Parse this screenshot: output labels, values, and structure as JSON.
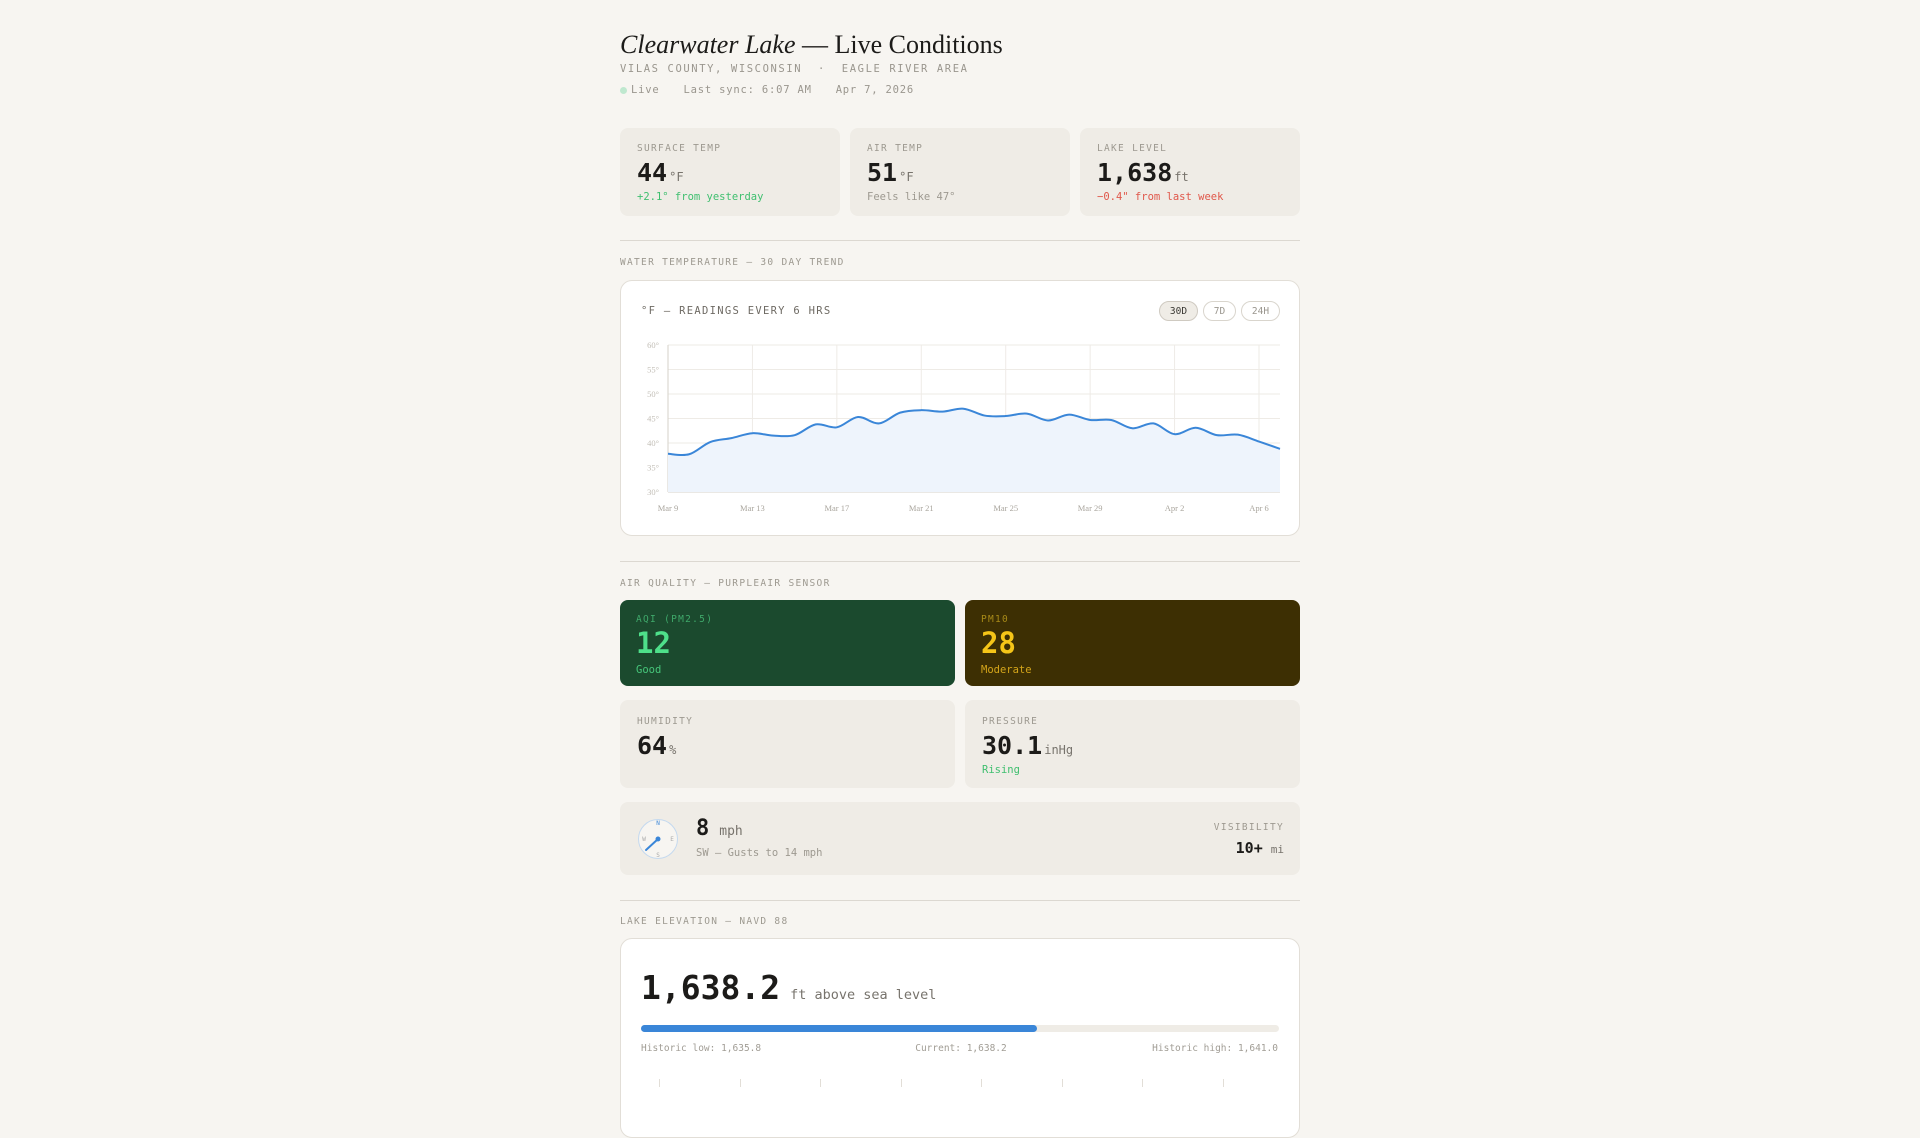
{
  "header": {
    "title_italic": "Clearwater Lake",
    "title_rest": " — Live Conditions",
    "location": "VILAS COUNTY, WISCONSIN  ·  EAGLE RIVER AREA",
    "live_label": "Live",
    "last_sync": "Last sync: 6:07 AM",
    "date": "Apr 7, 2026"
  },
  "stats": [
    {
      "label": "SURFACE TEMP",
      "value": "44",
      "unit": "°F",
      "note": "+2.1° from yesterday",
      "note_color": "#3fbf6f"
    },
    {
      "label": "AIR TEMP",
      "value": "51",
      "unit": "°F",
      "note": "Feels like 47°",
      "note_color": "#9d9990"
    },
    {
      "label": "LAKE LEVEL",
      "value": "1,638",
      "unit": "ft",
      "note": "−0.4\" from last week",
      "note_color": "#e0574a"
    }
  ],
  "water": {
    "section": "WATER TEMPERATURE — 30 DAY TREND",
    "subtitle": "°F — READINGS EVERY 6 HRS",
    "ranges": [
      "30D",
      "7D",
      "24H"
    ],
    "active_range": "30D"
  },
  "chart_data": {
    "type": "area",
    "title": "°F — READINGS EVERY 6 HRS",
    "xlabel": "",
    "ylabel": "°F",
    "ylim": [
      30,
      60
    ],
    "yticks": [
      "60°",
      "55°",
      "50°",
      "45°",
      "40°",
      "35°",
      "30°"
    ],
    "xticks": [
      "Mar 9",
      "Mar 13",
      "Mar 17",
      "Mar 21",
      "Mar 25",
      "Mar 29",
      "Apr 2",
      "Apr 6"
    ],
    "x_start": "Mar 9",
    "values": [
      37.8,
      37.7,
      40.2,
      41.0,
      42.0,
      41.5,
      41.6,
      43.8,
      43.2,
      45.3,
      44.0,
      46.2,
      46.7,
      46.4,
      47.0,
      45.6,
      45.5,
      46.0,
      44.6,
      45.8,
      44.7,
      44.7,
      43.0,
      44.0,
      41.8,
      43.1,
      41.6,
      41.7,
      40.3,
      38.8
    ],
    "color": "#3a86d8",
    "grid": true
  },
  "air": {
    "section": "AIR QUALITY — PURPLEAIR SENSOR",
    "aqi": {
      "label": "AQI (PM2.5)",
      "value": "12",
      "status": "Good"
    },
    "pm10": {
      "label": "PM10",
      "value": "28",
      "status": "Moderate"
    },
    "humidity": {
      "label": "HUMIDITY",
      "value": "64",
      "unit": "%"
    },
    "pressure": {
      "label": "PRESSURE",
      "value": "30.1",
      "unit": "inHg",
      "trend": "Rising"
    }
  },
  "wind": {
    "speed": "8",
    "unit": "mph",
    "detail": "SW — Gusts to 14 mph",
    "compass": {
      "n": "N",
      "e": "E",
      "s": "S",
      "w": "W"
    },
    "visibility_label": "VISIBILITY",
    "visibility": "10+",
    "visibility_unit": "mi"
  },
  "elevation": {
    "section": "LAKE ELEVATION — NAVD 88",
    "value": "1,638.2",
    "unit": "ft above sea level",
    "fill_percent": 62,
    "low": "Historic low: 1,635.8",
    "current": "Current: 1,638.2",
    "high": "Historic high: 1,641.0"
  }
}
